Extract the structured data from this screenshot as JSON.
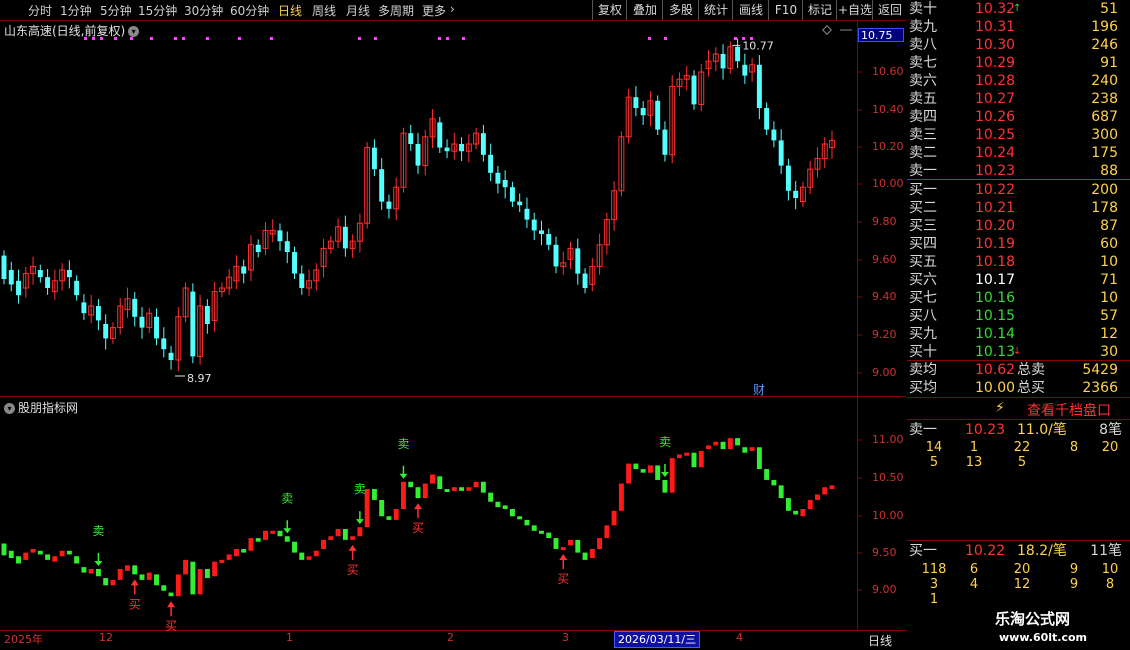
{
  "toolbar": {
    "periods": [
      "分时",
      "1分钟",
      "5分钟",
      "15分钟",
      "30分钟",
      "60分钟",
      "日线",
      "周线",
      "月线",
      "多周期",
      "更多"
    ],
    "active_period": "日线",
    "more_arrow": "›",
    "buttons": [
      "复权",
      "叠加",
      "多股",
      "统计",
      "画线",
      "F10",
      "标记",
      "+自选",
      "返回"
    ]
  },
  "main_chart": {
    "title": "山东高速(日线,前复权)",
    "high_label": "10.77",
    "low_label": "8.97",
    "current_price": "10.75",
    "cai_badge": "财",
    "y_ticks": [
      "10.60",
      "10.40",
      "10.20",
      "10.00",
      "9.80",
      "9.60",
      "9.40",
      "9.20",
      "9.00"
    ]
  },
  "indicator_chart": {
    "title": "股朋指标网",
    "sell_label": "卖",
    "buy_label": "买",
    "y_ticks": [
      "11.00",
      "10.50",
      "10.00",
      "9.50",
      "9.00"
    ]
  },
  "x_axis": {
    "labels": [
      "2025年",
      "12",
      "1",
      "2",
      "3",
      "4"
    ],
    "cursor_date": "2026/03/11/三",
    "period_label": "日线"
  },
  "order_book": {
    "sells": [
      {
        "label": "卖十",
        "price": "10.32",
        "vol": "51",
        "price_color": "red",
        "mark": "↑"
      },
      {
        "label": "卖九",
        "price": "10.31",
        "vol": "196",
        "price_color": "red"
      },
      {
        "label": "卖八",
        "price": "10.30",
        "vol": "246",
        "price_color": "red"
      },
      {
        "label": "卖七",
        "price": "10.29",
        "vol": "91",
        "price_color": "red"
      },
      {
        "label": "卖六",
        "price": "10.28",
        "vol": "240",
        "price_color": "red"
      },
      {
        "label": "卖五",
        "price": "10.27",
        "vol": "238",
        "price_color": "red"
      },
      {
        "label": "卖四",
        "price": "10.26",
        "vol": "687",
        "price_color": "red"
      },
      {
        "label": "卖三",
        "price": "10.25",
        "vol": "300",
        "price_color": "red"
      },
      {
        "label": "卖二",
        "price": "10.24",
        "vol": "175",
        "price_color": "red"
      },
      {
        "label": "卖一",
        "price": "10.23",
        "vol": "88",
        "price_color": "red"
      }
    ],
    "buys": [
      {
        "label": "买一",
        "price": "10.22",
        "vol": "200",
        "price_color": "red"
      },
      {
        "label": "买二",
        "price": "10.21",
        "vol": "178",
        "price_color": "red"
      },
      {
        "label": "买三",
        "price": "10.20",
        "vol": "87",
        "price_color": "red"
      },
      {
        "label": "买四",
        "price": "10.19",
        "vol": "60",
        "price_color": "red"
      },
      {
        "label": "买五",
        "price": "10.18",
        "vol": "10",
        "price_color": "red"
      },
      {
        "label": "买六",
        "price": "10.17",
        "vol": "71",
        "price_color": "white"
      },
      {
        "label": "买七",
        "price": "10.16",
        "vol": "10",
        "price_color": "green"
      },
      {
        "label": "买八",
        "price": "10.15",
        "vol": "57",
        "price_color": "green"
      },
      {
        "label": "买九",
        "price": "10.14",
        "vol": "12",
        "price_color": "green"
      },
      {
        "label": "买十",
        "price": "10.13",
        "vol": "30",
        "price_color": "green",
        "mark": "↓"
      }
    ],
    "avg_sell": {
      "label": "卖均",
      "price": "10.62",
      "total_label": "总卖",
      "total": "5429"
    },
    "avg_buy": {
      "label": "买均",
      "price": "10.00",
      "total_label": "总买",
      "total": "2366"
    },
    "view_thousand": "查看千档盘口",
    "sell1_detail": {
      "label": "卖一",
      "price": "10.23",
      "avg": "11.0/笔",
      "count": "8笔",
      "rows": [
        [
          "14",
          "1",
          "22",
          "8",
          "20"
        ],
        [
          "5",
          "13",
          "5",
          "",
          ""
        ]
      ]
    },
    "buy1_detail": {
      "label": "买一",
      "price": "10.22",
      "avg": "18.2/笔",
      "count": "11笔",
      "rows": [
        [
          "118",
          "6",
          "20",
          "9",
          "10"
        ],
        [
          "3",
          "4",
          "12",
          "9",
          "8"
        ],
        [
          "1",
          "",
          "",
          "",
          ""
        ]
      ]
    }
  },
  "watermark": {
    "name": "乐淘公式网",
    "url": "www.60lt.com"
  },
  "colors": {
    "up": "#ff3030",
    "down": "#54ffff",
    "ind_up": "#ff1a1a",
    "ind_down": "#33ee33",
    "axis": "#8b0000"
  },
  "chart_data": {
    "type": "candlestick",
    "title": "山东高速(日线,前复权)",
    "x_labels": [
      "2025年",
      "12",
      "1",
      "2",
      "3",
      "4"
    ],
    "ylim": [
      8.9,
      10.8
    ],
    "candles": [
      [
        9.58,
        9.45
      ],
      [
        9.5,
        9.42
      ],
      [
        9.44,
        9.36
      ],
      [
        9.4,
        9.48
      ],
      [
        9.48,
        9.52
      ],
      [
        9.5,
        9.46
      ],
      [
        9.46,
        9.4
      ],
      [
        9.38,
        9.44
      ],
      [
        9.44,
        9.5
      ],
      [
        9.5,
        9.46
      ],
      [
        9.44,
        9.36
      ],
      [
        9.32,
        9.26
      ],
      [
        9.25,
        9.3
      ],
      [
        9.3,
        9.22
      ],
      [
        9.2,
        9.12
      ],
      [
        9.12,
        9.18
      ],
      [
        9.18,
        9.3
      ],
      [
        9.28,
        9.34
      ],
      [
        9.34,
        9.24
      ],
      [
        9.24,
        9.18
      ],
      [
        9.18,
        9.26
      ],
      [
        9.24,
        9.12
      ],
      [
        9.12,
        9.06
      ],
      [
        9.04,
        9.0
      ],
      [
        9.0,
        9.24
      ],
      [
        9.24,
        9.4
      ],
      [
        9.38,
        9.02
      ],
      [
        9.02,
        9.3
      ],
      [
        9.3,
        9.2
      ],
      [
        9.22,
        9.38
      ],
      [
        9.38,
        9.4
      ],
      [
        9.4,
        9.46
      ],
      [
        9.44,
        9.52
      ],
      [
        9.52,
        9.48
      ],
      [
        9.5,
        9.64
      ],
      [
        9.64,
        9.6
      ],
      [
        9.62,
        9.72
      ],
      [
        9.7,
        9.72
      ],
      [
        9.72,
        9.66
      ],
      [
        9.66,
        9.6
      ],
      [
        9.6,
        9.48
      ],
      [
        9.48,
        9.4
      ],
      [
        9.4,
        9.44
      ],
      [
        9.44,
        9.5
      ],
      [
        9.52,
        9.62
      ],
      [
        9.62,
        9.66
      ],
      [
        9.66,
        9.74
      ],
      [
        9.74,
        9.62
      ],
      [
        9.62,
        9.66
      ],
      [
        9.66,
        9.76
      ],
      [
        9.76,
        10.18
      ],
      [
        10.18,
        10.06
      ],
      [
        10.06,
        9.88
      ],
      [
        9.88,
        9.84
      ],
      [
        9.84,
        9.96
      ],
      [
        9.96,
        10.26
      ],
      [
        10.26,
        10.2
      ],
      [
        10.2,
        10.08
      ],
      [
        10.08,
        10.24
      ],
      [
        10.24,
        10.34
      ],
      [
        10.32,
        10.18
      ],
      [
        10.18,
        10.16
      ],
      [
        10.16,
        10.2
      ],
      [
        10.2,
        10.16
      ],
      [
        10.16,
        10.2
      ],
      [
        10.2,
        10.26
      ],
      [
        10.26,
        10.14
      ],
      [
        10.14,
        10.04
      ],
      [
        10.04,
        9.98
      ],
      [
        10.0,
        9.96
      ],
      [
        9.96,
        9.88
      ],
      [
        9.88,
        9.86
      ],
      [
        9.84,
        9.78
      ],
      [
        9.78,
        9.72
      ],
      [
        9.72,
        9.7
      ],
      [
        9.7,
        9.64
      ],
      [
        9.64,
        9.52
      ],
      [
        9.52,
        9.54
      ],
      [
        9.56,
        9.62
      ],
      [
        9.62,
        9.48
      ],
      [
        9.48,
        9.4
      ],
      [
        9.42,
        9.52
      ],
      [
        9.52,
        9.64
      ],
      [
        9.64,
        9.78
      ],
      [
        9.78,
        9.94
      ],
      [
        9.94,
        10.24
      ],
      [
        10.24,
        10.46
      ],
      [
        10.46,
        10.4
      ],
      [
        10.4,
        10.36
      ],
      [
        10.36,
        10.44
      ],
      [
        10.44,
        10.28
      ],
      [
        10.28,
        10.14
      ],
      [
        10.14,
        10.52
      ],
      [
        10.52,
        10.56
      ],
      [
        10.56,
        10.58
      ],
      [
        10.58,
        10.42
      ],
      [
        10.42,
        10.6
      ],
      [
        10.62,
        10.66
      ],
      [
        10.66,
        10.7
      ],
      [
        10.7,
        10.62
      ],
      [
        10.62,
        10.74
      ],
      [
        10.74,
        10.66
      ],
      [
        10.64,
        10.58
      ],
      [
        10.6,
        10.64
      ],
      [
        10.64,
        10.4
      ],
      [
        10.4,
        10.28
      ],
      [
        10.28,
        10.22
      ],
      [
        10.22,
        10.08
      ],
      [
        10.08,
        9.94
      ],
      [
        9.94,
        9.9
      ],
      [
        9.88,
        9.96
      ],
      [
        9.96,
        10.06
      ],
      [
        10.06,
        10.12
      ],
      [
        10.12,
        10.2
      ],
      [
        10.18,
        10.22
      ]
    ],
    "indicator": {
      "ylim": [
        8.9,
        11.3
      ],
      "sell_signals": [
        13,
        39,
        49,
        55,
        91
      ],
      "buy_signals": [
        18,
        23,
        48,
        57,
        77
      ]
    }
  }
}
